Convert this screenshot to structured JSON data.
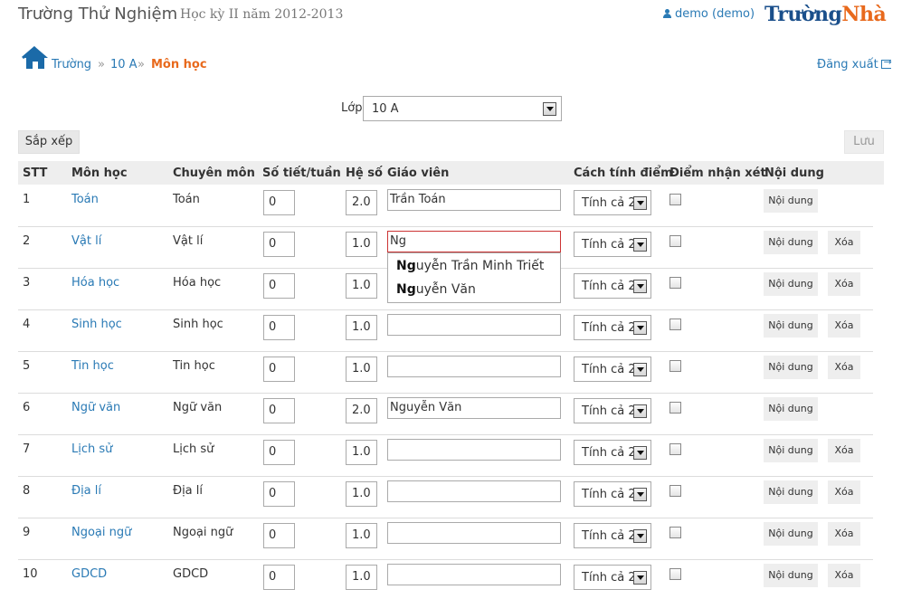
{
  "header": {
    "school_name": "Trường Thử Nghiệm",
    "term": "Học kỳ II năm 2012-2013",
    "user": "demo (demo)",
    "brand_part1": "Trường",
    "brand_part2": "Nhà",
    "user_icon": "user-icon"
  },
  "breadcrumb": {
    "home": "Trường",
    "separator": "»",
    "class": "10 A",
    "current": "Môn học",
    "home_icon": "house-icon"
  },
  "logout": {
    "label": "Đăng xuất",
    "icon": "sign-out-icon"
  },
  "class_filter": {
    "label": "Lớp",
    "value": "10 A"
  },
  "toolbar": {
    "sort_label": "Sắp xếp",
    "save_label": "Lưu"
  },
  "table": {
    "headers": [
      "STT",
      "Môn học",
      "Chuyên môn",
      "Số tiết/tuần",
      "Hệ số",
      "Giáo viên",
      "Cách tính điểm",
      "Điểm nhận xét",
      "Nội dung"
    ],
    "content_button_label": "Nội dung",
    "delete_button_label": "Xóa",
    "rows": [
      {
        "stt": "1",
        "subject": "Toán",
        "specialty": "Toán",
        "periods": "0",
        "coef": "2.0",
        "teacher": "Trần Toán",
        "method": "Tính cả 2",
        "comment_only": false,
        "deletable": false
      },
      {
        "stt": "2",
        "subject": "Vật lí",
        "specialty": "Vật lí",
        "periods": "0",
        "coef": "1.0",
        "teacher": "Ng",
        "method": "Tính cả 2",
        "comment_only": false,
        "deletable": true
      },
      {
        "stt": "3",
        "subject": "Hóa học",
        "specialty": "Hóa học",
        "periods": "0",
        "coef": "1.0",
        "teacher": "",
        "method": "Tính cả 2",
        "comment_only": false,
        "deletable": true
      },
      {
        "stt": "4",
        "subject": "Sinh học",
        "specialty": "Sinh học",
        "periods": "0",
        "coef": "1.0",
        "teacher": "",
        "method": "Tính cả 2",
        "comment_only": false,
        "deletable": true
      },
      {
        "stt": "5",
        "subject": "Tin học",
        "specialty": "Tin học",
        "periods": "0",
        "coef": "1.0",
        "teacher": "",
        "method": "Tính cả 2",
        "comment_only": false,
        "deletable": true
      },
      {
        "stt": "6",
        "subject": "Ngữ văn",
        "specialty": "Ngữ văn",
        "periods": "0",
        "coef": "2.0",
        "teacher": "Nguyễn Văn",
        "method": "Tính cả 2",
        "comment_only": false,
        "deletable": false
      },
      {
        "stt": "7",
        "subject": "Lịch sử",
        "specialty": "Lịch sử",
        "periods": "0",
        "coef": "1.0",
        "teacher": "",
        "method": "Tính cả 2",
        "comment_only": false,
        "deletable": true
      },
      {
        "stt": "8",
        "subject": "Địa lí",
        "specialty": "Địa lí",
        "periods": "0",
        "coef": "1.0",
        "teacher": "",
        "method": "Tính cả 2",
        "comment_only": false,
        "deletable": true
      },
      {
        "stt": "9",
        "subject": "Ngoại ngữ",
        "specialty": "Ngoại ngữ",
        "periods": "0",
        "coef": "1.0",
        "teacher": "",
        "method": "Tính cả 2",
        "comment_only": false,
        "deletable": true
      },
      {
        "stt": "10",
        "subject": "GDCD",
        "specialty": "GDCD",
        "periods": "0",
        "coef": "1.0",
        "teacher": "",
        "method": "Tính cả 2",
        "comment_only": false,
        "deletable": true
      }
    ]
  },
  "autocomplete": {
    "query": "Ng",
    "suggestions": [
      {
        "match": "Ng",
        "rest": "uyễn Trần Minh Triết"
      },
      {
        "match": "Ng",
        "rest": "uyễn Văn"
      }
    ]
  },
  "colors": {
    "link": "#2a7ab5",
    "accent": "#e8691c",
    "brand_blue": "#1a4f8b",
    "header_bg": "#eeeeee"
  }
}
